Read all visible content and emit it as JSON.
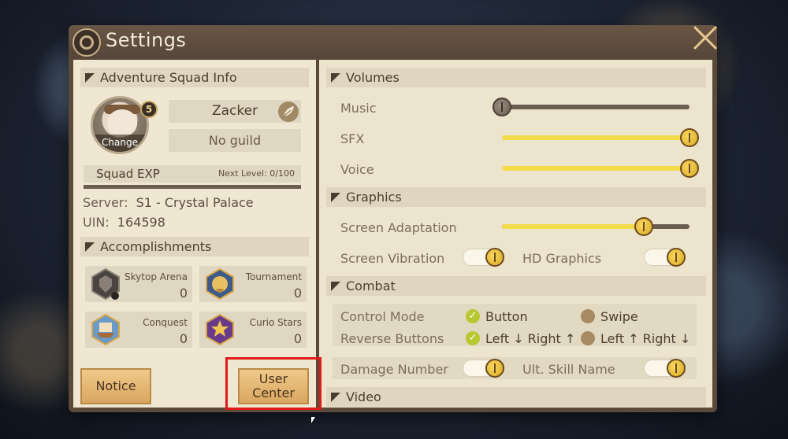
{
  "window": {
    "title": "Settings"
  },
  "left": {
    "squad_header": "Adventure Squad Info",
    "avatar_change": "Change",
    "level": "5",
    "name": "Zacker",
    "guild": "No guild",
    "exp_label": "Squad EXP",
    "exp_next": "Next Level: 0/100",
    "exp_progress": 0,
    "server_label": "Server:",
    "server_value": "S1 - Crystal Palace",
    "uin_label": "UIN:",
    "uin_value": "164598",
    "accomplishments_header": "Accomplishments",
    "accomplishments": [
      {
        "name": "Skytop Arena",
        "value": "0",
        "icon": "shield-icon"
      },
      {
        "name": "Tournament",
        "value": "0",
        "icon": "trophy-icon"
      },
      {
        "name": "Conquest",
        "value": "0",
        "icon": "ship-icon"
      },
      {
        "name": "Curio Stars",
        "value": "0",
        "icon": "star-icon"
      }
    ],
    "notice_button": "Notice",
    "user_center_button": "User\nCenter"
  },
  "right": {
    "volumes_header": "Volumes",
    "music": {
      "label": "Music",
      "level": 0
    },
    "sfx": {
      "label": "SFX",
      "level": 1.0
    },
    "voice": {
      "label": "Voice",
      "level": 1.0
    },
    "graphics_header": "Graphics",
    "screen_adaptation": {
      "label": "Screen Adaptation",
      "level": 0.75
    },
    "screen_vibration": {
      "label": "Screen Vibration",
      "on": true
    },
    "hd_graphics": {
      "label": "HD Graphics",
      "on": true
    },
    "combat_header": "Combat",
    "control_mode": {
      "label": "Control Mode",
      "option_1": "Button",
      "option_2": "Swipe",
      "selected": "Button"
    },
    "reverse_buttons": {
      "label": "Reverse Buttons",
      "option_1": "Left ↓ Right ↑",
      "option_2": "Left ↑ Right ↓",
      "selected": "Left ↓ Right ↑"
    },
    "damage_number": {
      "label": "Damage Number",
      "on": true
    },
    "ult_skill_name": {
      "label": "Ult. Skill Name",
      "on": true
    },
    "video_header": "Video"
  },
  "colors": {
    "accent_gold": "#f3dc4a",
    "highlight_red": "#e0191a",
    "panel_bg": "#efe7d2"
  }
}
